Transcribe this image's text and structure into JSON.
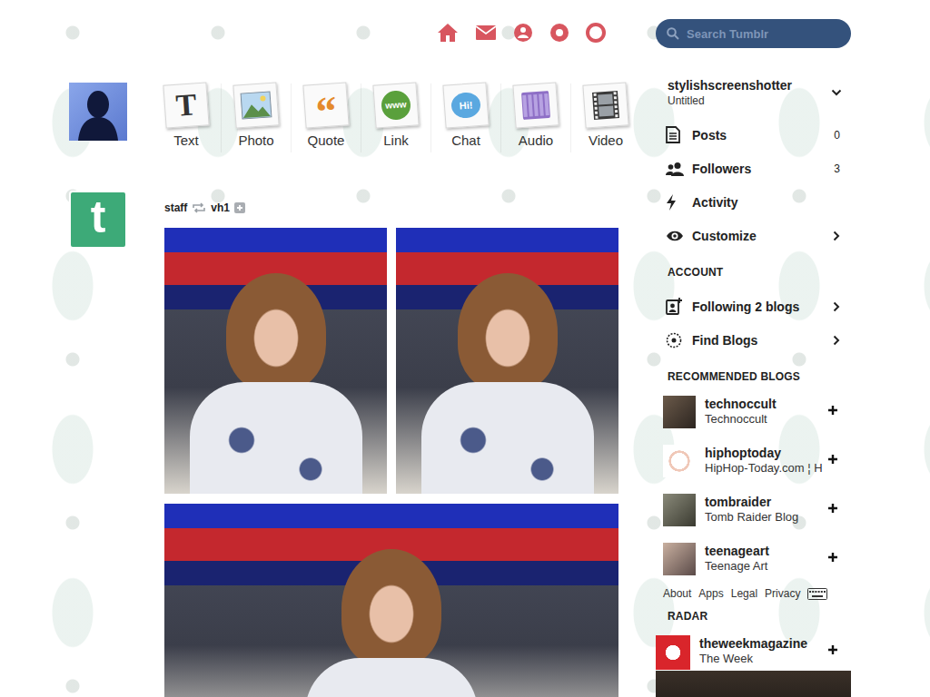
{
  "logo": "t",
  "search": {
    "placeholder": "Search Tumblr"
  },
  "post_types": [
    {
      "label": "Text",
      "kind": "text",
      "glyph": "T"
    },
    {
      "label": "Photo",
      "kind": "photo"
    },
    {
      "label": "Quote",
      "kind": "quote",
      "glyph": "“"
    },
    {
      "label": "Link",
      "kind": "link",
      "glyph": "www"
    },
    {
      "label": "Chat",
      "kind": "chat",
      "glyph": "Hi!"
    },
    {
      "label": "Audio",
      "kind": "audio"
    },
    {
      "label": "Video",
      "kind": "video"
    }
  ],
  "post": {
    "author": "staff",
    "reblogged_from": "vh1"
  },
  "blog": {
    "name": "stylishscreenshotter",
    "title": "Untitled"
  },
  "blog_menu": [
    {
      "label": "Posts",
      "kind": "posts",
      "count": "0",
      "arrow": false
    },
    {
      "label": "Followers",
      "kind": "followers",
      "count": "3",
      "arrow": false
    },
    {
      "label": "Activity",
      "kind": "activity",
      "arrow": false
    },
    {
      "label": "Customize",
      "kind": "customize",
      "arrow": true
    }
  ],
  "account": {
    "heading": "ACCOUNT",
    "items": [
      {
        "label": "Following 2 blogs",
        "kind": "following",
        "arrow": true
      },
      {
        "label": "Find Blogs",
        "kind": "find",
        "arrow": true
      }
    ]
  },
  "recommended": {
    "heading": "RECOMMENDED BLOGS",
    "blogs": [
      {
        "name": "technoccult",
        "title": "Technoccult"
      },
      {
        "name": "hiphoptoday",
        "title": "HipHop-Today.com ¦ H"
      },
      {
        "name": "tombraider",
        "title": "Tomb Raider Blog"
      },
      {
        "name": "teenageart",
        "title": "Teenage Art"
      }
    ]
  },
  "footer": {
    "links": [
      "About",
      "Apps",
      "Legal",
      "Privacy"
    ]
  },
  "radar": {
    "heading": "RADAR",
    "blogs": [
      {
        "name": "theweekmagazine",
        "title": "The Week"
      }
    ]
  }
}
